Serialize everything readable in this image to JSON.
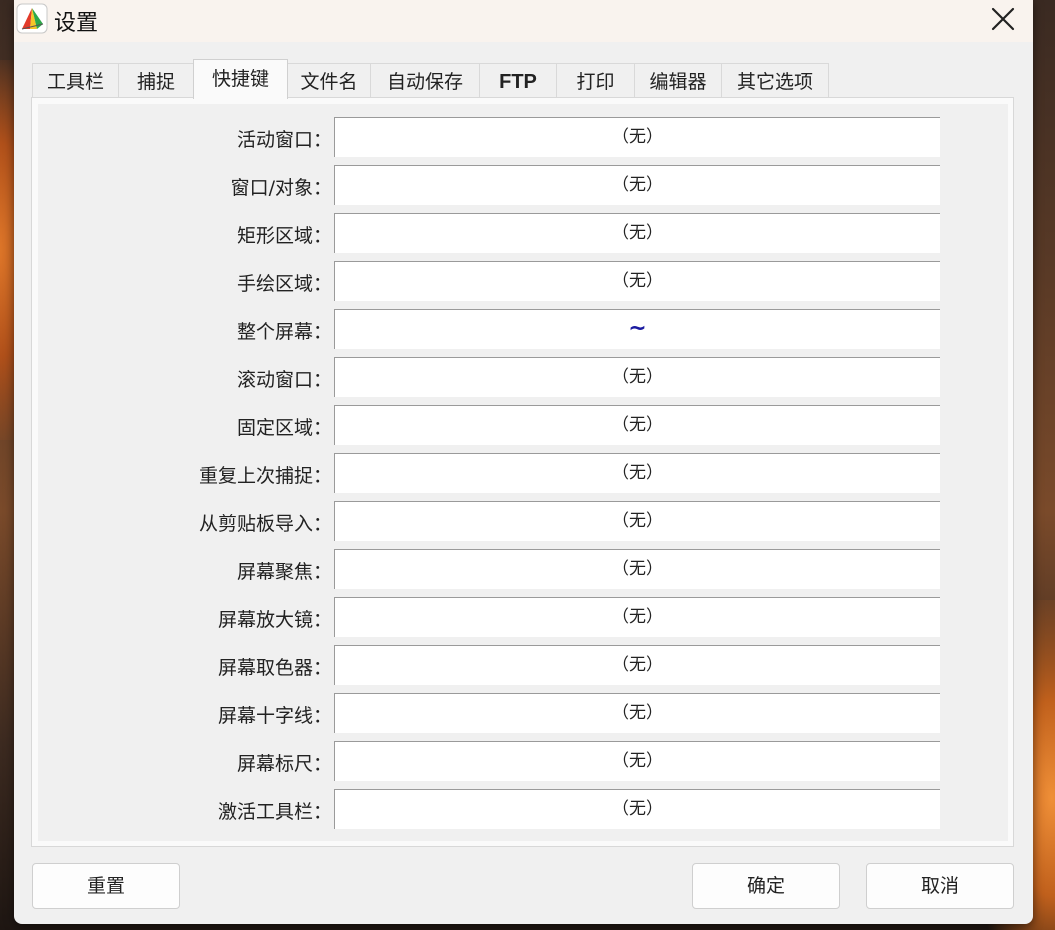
{
  "window": {
    "title": "设置"
  },
  "tabs": [
    {
      "label": "工具栏"
    },
    {
      "label": "捕捉"
    },
    {
      "label": "快捷键",
      "active": true
    },
    {
      "label": "文件名"
    },
    {
      "label": "自动保存"
    },
    {
      "label": "FTP"
    },
    {
      "label": "打印"
    },
    {
      "label": "编辑器"
    },
    {
      "label": "其它选项"
    }
  ],
  "hotkeys": [
    {
      "label": "活动窗口：",
      "value": "（无）"
    },
    {
      "label": "窗口/对象：",
      "value": "（无）"
    },
    {
      "label": "矩形区域：",
      "value": "（无）"
    },
    {
      "label": "手绘区域：",
      "value": "（无）"
    },
    {
      "label": "整个屏幕：",
      "value": "~"
    },
    {
      "label": "滚动窗口：",
      "value": "（无）"
    },
    {
      "label": "固定区域：",
      "value": "（无）"
    },
    {
      "label": "重复上次捕捉：",
      "value": "（无）"
    },
    {
      "label": "从剪贴板导入：",
      "value": "（无）"
    },
    {
      "label": "屏幕聚焦：",
      "value": "（无）"
    },
    {
      "label": "屏幕放大镜：",
      "value": "（无）"
    },
    {
      "label": "屏幕取色器：",
      "value": "（无）"
    },
    {
      "label": "屏幕十字线：",
      "value": "（无）"
    },
    {
      "label": "屏幕标尺：",
      "value": "（无）"
    },
    {
      "label": "激活工具栏：",
      "value": "（无）"
    }
  ],
  "buttons": {
    "reset": "重置",
    "ok": "确定",
    "cancel": "取消"
  },
  "icons": {
    "app": "faststone-capture-logo-icon",
    "close": "close-icon"
  },
  "colors": {
    "dialog_bg": "#f0f0f0",
    "titlebar_bg": "#f9f3ee",
    "field_bg": "#ffffff",
    "assigned_hotkey": "#1a1aa0"
  }
}
